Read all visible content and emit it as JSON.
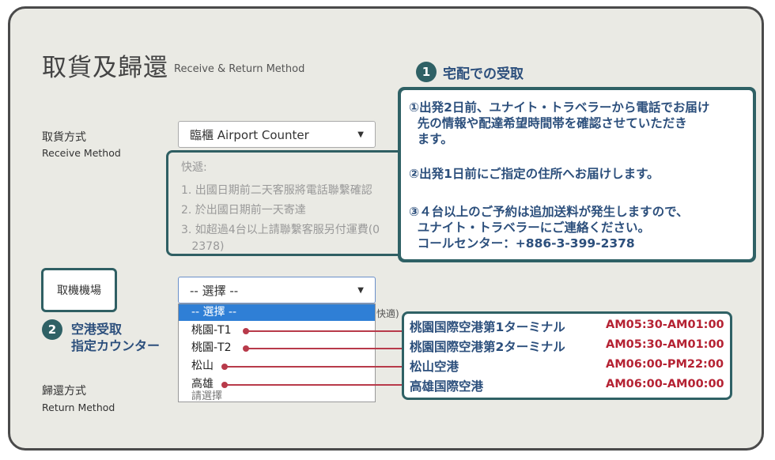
{
  "page": {
    "title_zh": "取貨及歸還",
    "title_en": "Receive & Return Method"
  },
  "receive_method": {
    "label_zh": "取貨方式",
    "label_en": "Receive Method",
    "selected": "臨櫃 Airport Counter"
  },
  "express_box": {
    "heading": "快遞:",
    "lines": [
      "1. 出國日期前二天客服將電話聯繫確認",
      "2. 於出國日期前一天寄達",
      "3. 如超過4台以上請聯繫客服另付運費(0",
      "   2378)"
    ]
  },
  "callout_delivery": {
    "number": "1",
    "heading": "宅配での受取",
    "lines": [
      "①出発2日前、ユナイト・トラベラーから電話でお届け",
      "  先の情報や配達希望時間帯を確認させていただき",
      "  ます。",
      "②出発1日前にご指定の住所へお届けします。",
      "③４台以上のご予約は追加送料が発生しますので、",
      "  ユナイト・トラベラーにご連絡ください。",
      "  コールセンター：+886-3-399-2378"
    ]
  },
  "pickup_airport": {
    "label": "取機機場",
    "selected": "-- 選擇 --",
    "partial_text": "快適)",
    "callout_number": "2",
    "callout_line1": "空港受取",
    "callout_line2": "指定カウンター",
    "options": [
      "-- 選擇 --",
      "桃園-T1",
      "桃園-T2",
      "松山",
      "高雄"
    ],
    "partial_option": "請選擇"
  },
  "terminals": [
    {
      "name": "桃園国際空港第1ターミナル",
      "hours": "AM05:30-AM01:00"
    },
    {
      "name": "桃園国際空港第2ターミナル",
      "hours": "AM05:30-AM01:00"
    },
    {
      "name": "松山空港",
      "hours": "AM06:00-PM22:00"
    },
    {
      "name": "高雄国際空港",
      "hours": "AM06:00-AM00:00"
    }
  ],
  "return_method": {
    "label_zh": "歸還方式",
    "label_en": "Return Method"
  },
  "colors": {
    "teal": "#2f6165",
    "navy_text": "#2c4f7c",
    "red_text": "#b52233",
    "selected_option": "#2f7fd6"
  }
}
